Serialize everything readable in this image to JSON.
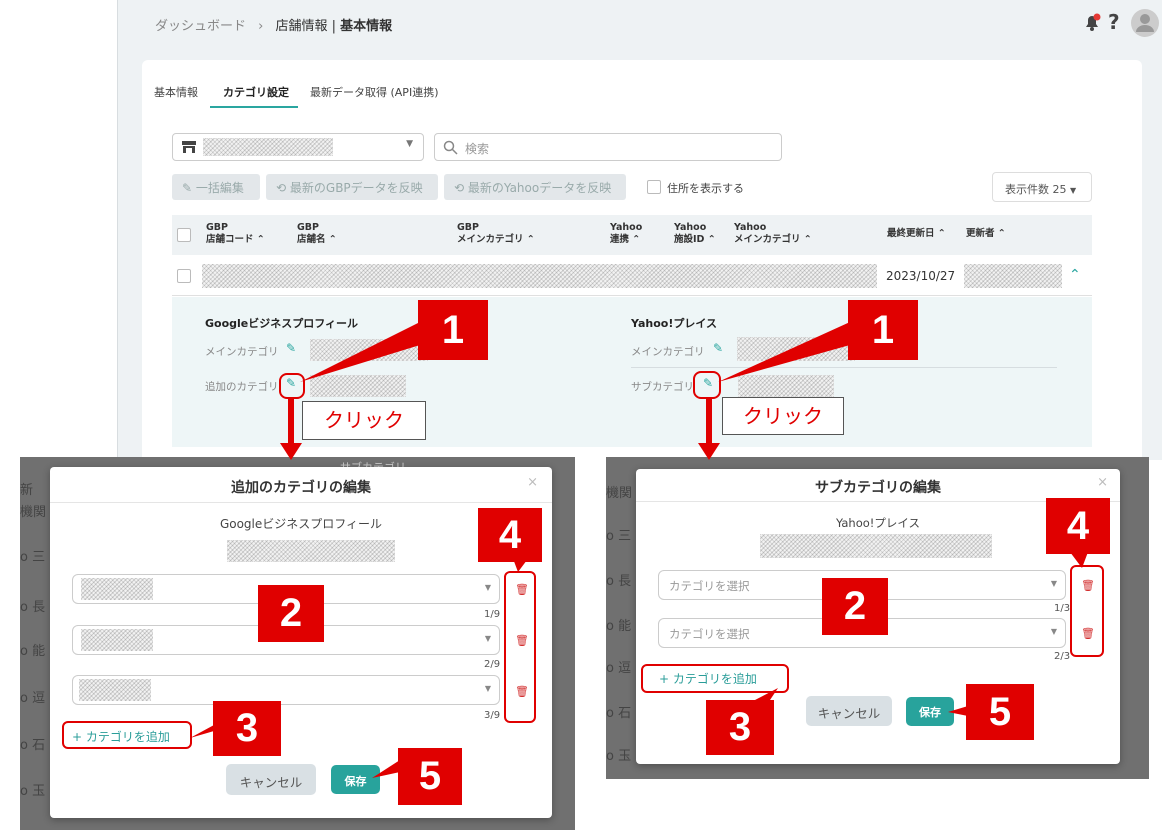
{
  "breadcrumb": {
    "home": "ダッシュボード",
    "sep": "›",
    "parent": "店舗情報 |",
    "current": "基本情報"
  },
  "tabs": [
    "基本情報",
    "カテゴリ設定",
    "最新データ取得 (API連携)"
  ],
  "search": {
    "placeholder": "検索"
  },
  "toolbar": {
    "bulk_edit": "一括編集",
    "gbp_reflect": "最新のGBPデータを反映",
    "yahoo_reflect": "最新のYahooデータを反映",
    "show_address": "住所を表示する",
    "per_page": "表示件数 25"
  },
  "table": {
    "headers": [
      "GBP\n店舗コード",
      "GBP\n店舗名",
      "GBP\nメインカテゴリ",
      "Yahoo\n連携",
      "Yahoo\n施設ID",
      "Yahoo\nメインカテゴリ",
      "最終更新日",
      "更新者"
    ],
    "row_date": "2023/10/27"
  },
  "detail": {
    "google_title": "Googleビジネスプロフィール",
    "main_category": "メインカテゴリ",
    "additional_category": "追加のカテゴリ",
    "yahoo_title": "Yahoo!プレイス",
    "yahoo_main_category": "メインカテゴリ",
    "sub_category": "サブカテゴリ"
  },
  "modal_left": {
    "title": "追加のカテゴリの編集",
    "subtitle": "Googleビジネスプロフィール",
    "counts": [
      "1/9",
      "2/9",
      "3/9"
    ],
    "add_label": "+ カテゴリを追加",
    "cancel": "キャンセル",
    "save": "保存"
  },
  "modal_right": {
    "title": "サブカテゴリの編集",
    "subtitle": "Yahoo!プレイス",
    "placeholder": "カテゴリを選択",
    "counts": [
      "1/3",
      "2/3"
    ],
    "add_label": "+ カテゴリを追加",
    "cancel": "キャンセル",
    "save": "保存"
  },
  "bg_left": [
    "新",
    "機関",
    "o 三",
    "o 長",
    "o 能",
    "o 逗",
    "o 石",
    "o 玉"
  ],
  "bg_right": [
    "機関",
    "o 三",
    "o 長",
    "o 能",
    "o 逗",
    "o 石",
    "o 玉"
  ],
  "bg_strip": "サブカテゴリ",
  "annotations": {
    "n1": "1",
    "n2": "2",
    "n3": "3",
    "n4": "4",
    "n5": "5",
    "click": "クリック"
  },
  "icons": [
    "store-icon",
    "search-icon",
    "pencil-icon",
    "sync-icon",
    "chevron-up-icon",
    "bell-icon",
    "help-icon",
    "avatar-icon",
    "trash-icon",
    "close-icon"
  ],
  "colors": {
    "accent": "#2aa6a0",
    "annotation_red": "#e00000",
    "danger": "#d32f2f"
  }
}
